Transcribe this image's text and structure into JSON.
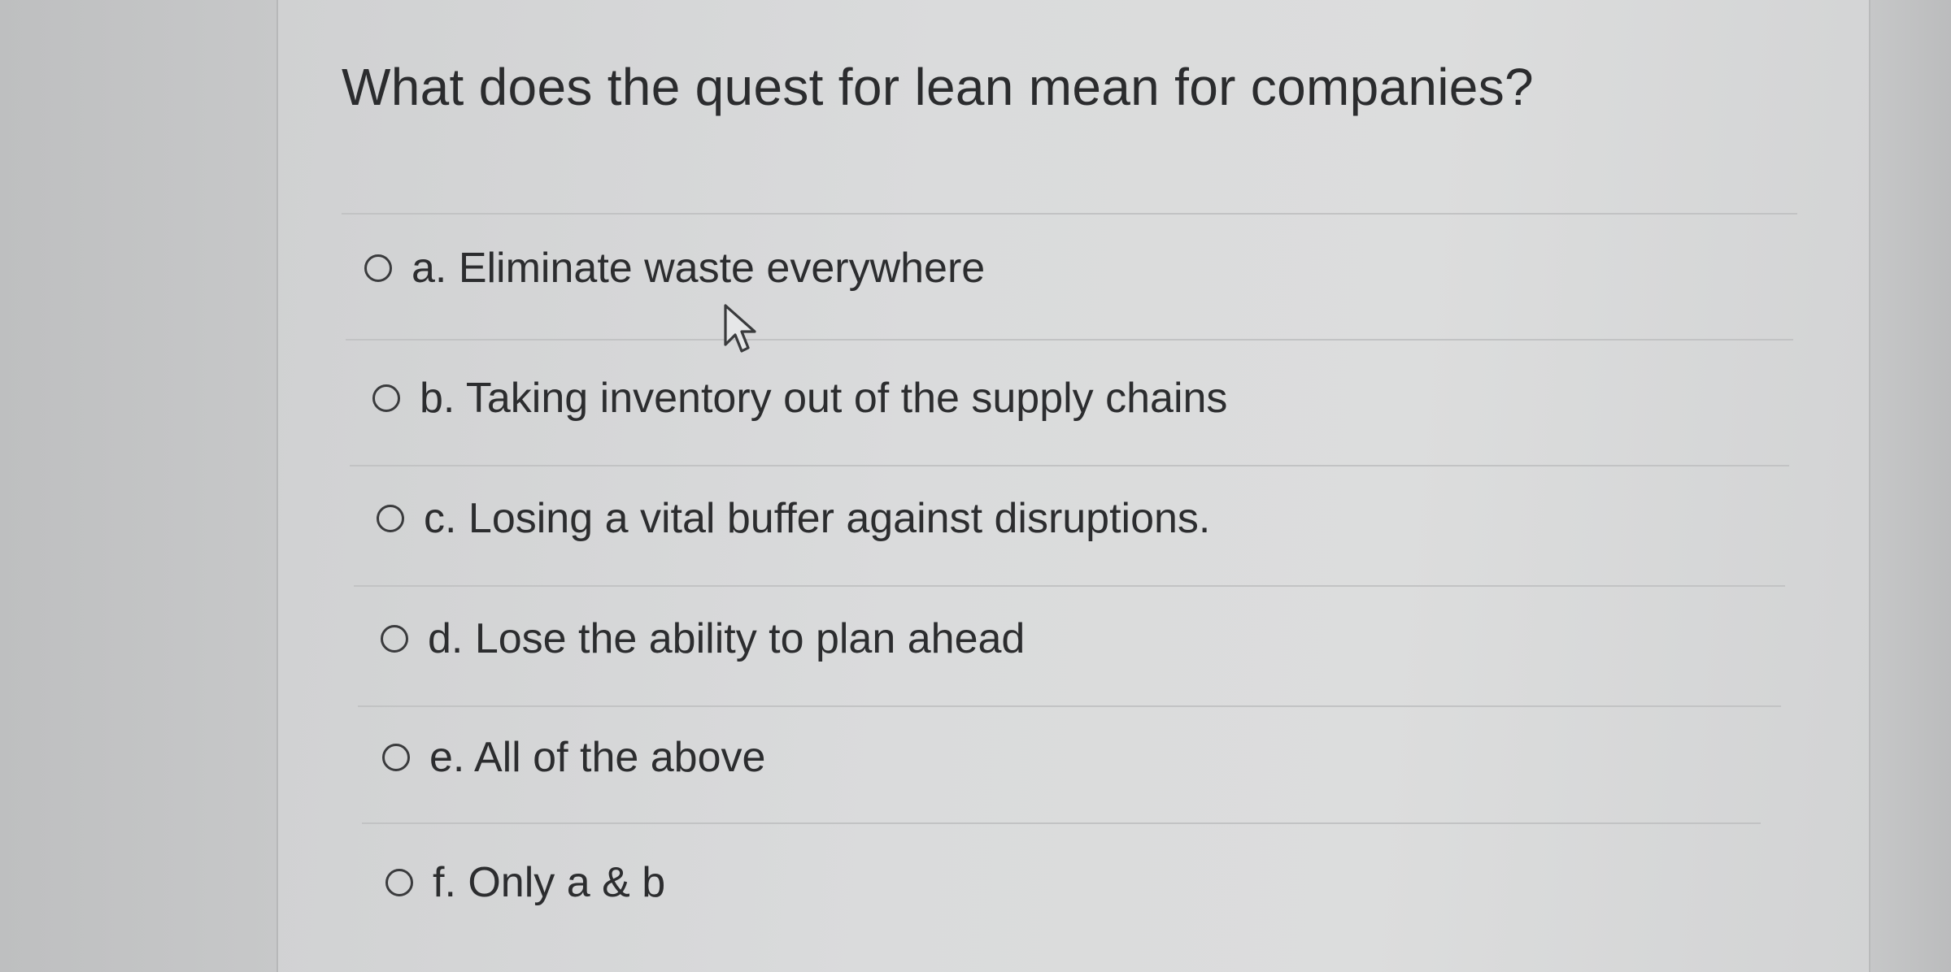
{
  "question": {
    "text": "What does the quest for lean mean for companies?"
  },
  "options": [
    {
      "label": "a. Eliminate waste everywhere",
      "selected": false
    },
    {
      "label": "b. Taking inventory out of the supply chains",
      "selected": false
    },
    {
      "label": "c. Losing a vital buffer against disruptions.",
      "selected": false
    },
    {
      "label": "d. Lose the ability to plan ahead",
      "selected": false
    },
    {
      "label": "e. All of the above",
      "selected": false
    },
    {
      "label": "f. Only a & b",
      "selected": false
    }
  ],
  "colors": {
    "text": "#2c2d2f",
    "radio_border": "#3a3b3d",
    "background": "#d8d9da"
  }
}
